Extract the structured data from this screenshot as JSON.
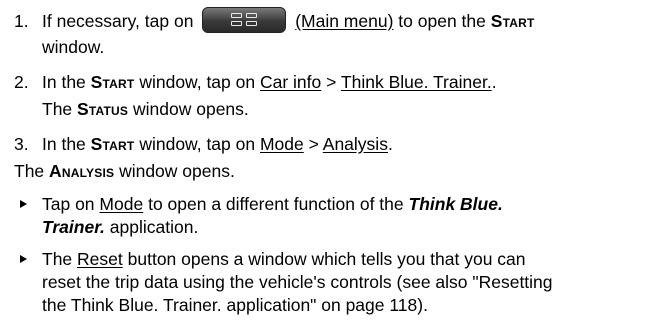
{
  "steps": [
    {
      "number": "1.",
      "line1_pre": "If necessary, tap on",
      "button_icon": "main-menu-icon",
      "link_main_menu": "(Main menu)",
      "line1_post": "to open the",
      "start_label": "Start",
      "line2": "window."
    },
    {
      "number": "2.",
      "pre": "In the",
      "start_label": "Start",
      "mid": "window, tap on",
      "link1": "Car info",
      "sep": ">",
      "link2": "Think Blue. Trainer.",
      "end": ".",
      "sub_pre": "The",
      "status_label": "Status",
      "sub_post": "window opens."
    },
    {
      "number": "3.",
      "pre": "In the",
      "start_label": "Start",
      "mid": "window, tap on",
      "link1": "Mode",
      "sep": ">",
      "link2": "Analysis",
      "end": "."
    }
  ],
  "result": {
    "pre": "The",
    "analysis_label": "Analysis",
    "post": "window opens."
  },
  "bullets": [
    {
      "pre": "Tap on",
      "link": "Mode",
      "mid": "to open a different function of the",
      "bold_italic_1": "Think Blue.",
      "bold_italic_2": "Trainer.",
      "post": "application."
    },
    {
      "pre": "The",
      "link": "Reset",
      "line1_post": "button opens a window which tells you that you can",
      "line2": "reset the trip data using the vehicle's controls (see also \"Resetting",
      "line3": "the Think Blue. Trainer. application\" on page 118)."
    }
  ]
}
